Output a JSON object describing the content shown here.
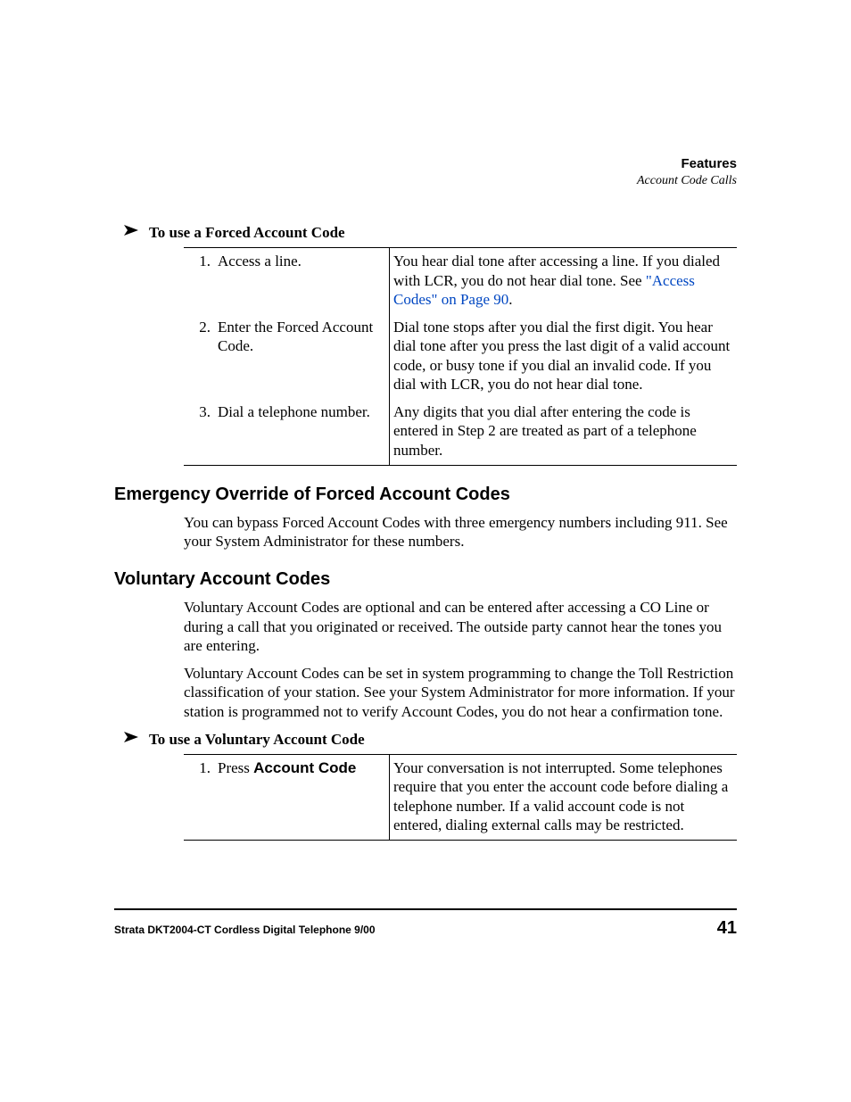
{
  "header": {
    "title": "Features",
    "subtitle": "Account Code Calls"
  },
  "proc1": {
    "title": "To use a Forced Account Code",
    "steps": [
      {
        "num": "1.",
        "action": "Access a line.",
        "result_a": "You hear dial tone after accessing a line. If you dialed with LCR, you do not hear dial tone. See ",
        "xref": "\"Access Codes\" on Page 90",
        "result_b": "."
      },
      {
        "num": "2.",
        "action": "Enter the Forced Account Code.",
        "result": "Dial tone stops after you dial the first digit. You hear dial tone after you press the last digit of a valid account code, or busy tone if you dial an invalid code. If you dial with LCR, you do not hear dial tone."
      },
      {
        "num": "3.",
        "action": "Dial a telephone number.",
        "result": "Any digits that you dial after entering the code is entered in Step 2 are treated as part of a telephone number."
      }
    ]
  },
  "section1": {
    "title": "Emergency Override of Forced Account Codes",
    "body1": "You can bypass Forced Account Codes with three emergency numbers including 911. See your System Administrator for these numbers."
  },
  "section2": {
    "title": "Voluntary Account Codes",
    "body1": "Voluntary Account Codes are optional and can be entered after accessing a CO Line or during a call that you originated or received. The outside party cannot hear the tones you are entering.",
    "body2": "Voluntary Account Codes can be set in system programming to change the Toll Restriction classification of your station. See your System Administrator for more information. If your station is programmed not to verify Account Codes, you do not hear a confirmation tone."
  },
  "proc2": {
    "title": "To use a Voluntary Account Code",
    "steps": [
      {
        "num": "1.",
        "action_prefix": "Press ",
        "action_button": "Account Code",
        "result": "Your conversation is not interrupted. Some telephones require that you enter the account code before dialing a telephone number. If a valid account code is not entered, dialing external calls may be restricted."
      }
    ]
  },
  "footer": {
    "left": "Strata DKT2004-CT Cordless Digital Telephone   9/00",
    "page": "41"
  }
}
